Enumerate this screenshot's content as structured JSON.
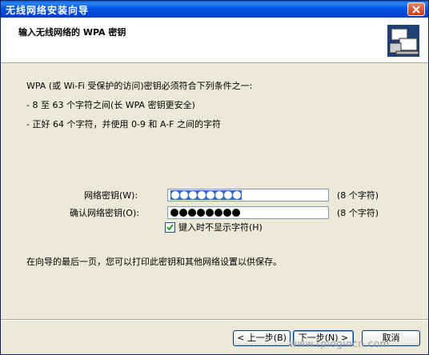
{
  "window": {
    "title": "无线网络安装向导"
  },
  "header": {
    "title": "输入无线网络的 WPA 密钥"
  },
  "content": {
    "intro": "WPA (或 Wi-Fi 受保护的访问)密钥必须符合下列条件之一:",
    "cond1": "- 8 至 63 个字符之间(长 WPA 密钥更安全)",
    "cond2": "- 正好 64 个字符，并使用 0-9 和 A-F 之间的字符",
    "key_label": "网络密钥(W):",
    "key_count": "(8 个字符)",
    "confirm_label": "确认网络密钥(O):",
    "confirm_count": "(8 个字符)",
    "hide_chars_label": "键入时不显示字符(H)",
    "hide_chars_checked": true,
    "footer_note": "在向导的最后一页，您可以打印此密钥和其他网络设置以供保存。",
    "password_length": 8
  },
  "buttons": {
    "back": "< 上一步(B)",
    "next": "下一步(N) >",
    "cancel": "取消"
  },
  "watermark": "www.tplogincn.com"
}
